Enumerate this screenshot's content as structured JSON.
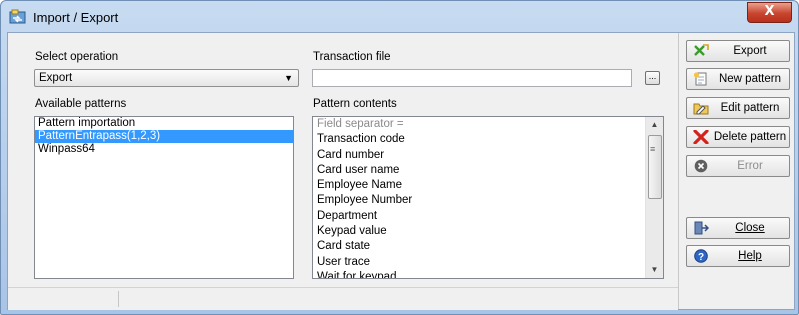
{
  "window": {
    "title": "Import / Export",
    "close_glyph": "X"
  },
  "operation": {
    "label": "Select operation",
    "value": "Export"
  },
  "transaction_file": {
    "label": "Transaction file",
    "value": "",
    "browse_label": "..."
  },
  "available_patterns": {
    "label": "Available patterns",
    "items": [
      "Pattern importation",
      "PatternEntrapass(1,2,3)",
      "Winpass64"
    ],
    "selected_index": 1
  },
  "pattern_contents": {
    "label": "Pattern contents",
    "items": [
      "Field separator =",
      "Transaction code",
      "Card number",
      "Card user name",
      "Employee Name",
      "Employee Number",
      "Department",
      "Keypad value",
      "Card state",
      "User trace",
      "Wait for keypad"
    ]
  },
  "buttons": {
    "export": "Export",
    "new_pattern": "New pattern",
    "edit_pattern": "Edit pattern",
    "delete_pattern": "Delete pattern",
    "error": "Error",
    "close": "Close",
    "help": "Help"
  },
  "icons": {
    "app": "import-export-icon",
    "export": "export-arrows-icon",
    "new_pattern": "new-document-icon",
    "edit_pattern": "edit-folder-icon",
    "delete_pattern": "red-x-icon",
    "error": "error-circle-icon",
    "close": "exit-door-icon",
    "help": "help-icon"
  },
  "colors": {
    "selection": "#3399ff",
    "title_bar": "#c7dbf1",
    "close_button": "#c8452e"
  }
}
